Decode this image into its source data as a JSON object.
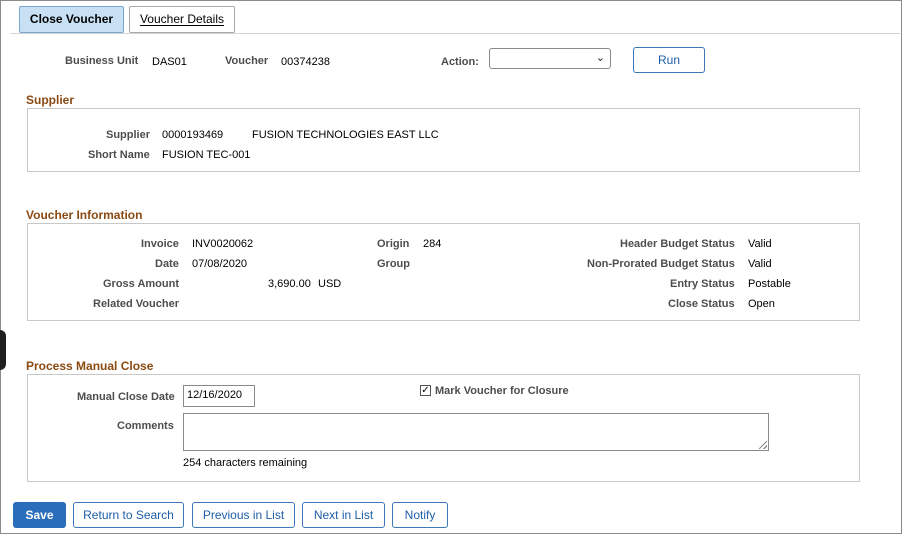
{
  "tabs": [
    {
      "label": "Close Voucher",
      "active": true
    },
    {
      "label": "Voucher Details",
      "active": false
    }
  ],
  "header": {
    "business_unit_label": "Business Unit",
    "business_unit_value": "DAS01",
    "voucher_label": "Voucher",
    "voucher_value": "00374238",
    "action_label": "Action:",
    "action_value": "",
    "run_label": "Run"
  },
  "supplier": {
    "title": "Supplier",
    "supplier_label": "Supplier",
    "supplier_id": "0000193469",
    "supplier_name": "FUSION TECHNOLOGIES EAST LLC",
    "short_name_label": "Short Name",
    "short_name_value": "FUSION TEC-001"
  },
  "voucher_info": {
    "title": "Voucher Information",
    "invoice_label": "Invoice",
    "invoice_value": "INV0020062",
    "date_label": "Date",
    "date_value": "07/08/2020",
    "gross_amount_label": "Gross Amount",
    "gross_amount_value": "3,690.00",
    "currency": "USD",
    "related_voucher_label": "Related Voucher",
    "origin_label": "Origin",
    "origin_value": "284",
    "group_label": "Group",
    "header_budget_label": "Header Budget Status",
    "header_budget_value": "Valid",
    "nonprorated_budget_label": "Non-Prorated Budget Status",
    "nonprorated_budget_value": "Valid",
    "entry_status_label": "Entry Status",
    "entry_status_value": "Postable",
    "close_status_label": "Close Status",
    "close_status_value": "Open"
  },
  "manual_close": {
    "title": "Process Manual Close",
    "close_date_label": "Manual Close Date",
    "close_date_value": "12/16/2020",
    "mark_label": "Mark Voucher for Closure",
    "mark_checked": true,
    "comments_label": "Comments",
    "comments_value": "",
    "chars_remaining": "254 characters remaining"
  },
  "footer": {
    "save_label": "Save",
    "return_label": "Return to Search",
    "prev_label": "Previous in List",
    "next_label": "Next in List",
    "notify_label": "Notify"
  },
  "colors": {
    "section_title": "#8a4a12",
    "active_tab": "#c7e0f4",
    "primary_button": "#2a6ebb"
  }
}
